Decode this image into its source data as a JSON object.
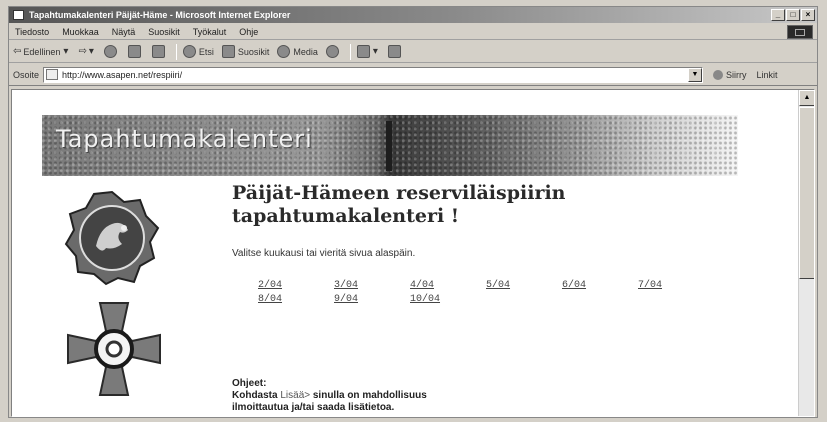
{
  "window": {
    "title": "Tapahtumakalenteri Päijät-Häme - Microsoft Internet Explorer",
    "buttons": {
      "minimize": "_",
      "maximize": "□",
      "close": "×"
    }
  },
  "menu": [
    "Tiedosto",
    "Muokkaa",
    "Näytä",
    "Suosikit",
    "Työkalut",
    "Ohje"
  ],
  "toolbar": {
    "back": "Edellinen",
    "search": "Etsi",
    "favorites": "Suosikit",
    "media": "Media"
  },
  "address": {
    "label": "Osoite",
    "url": "http://www.asapen.net/respiiri/",
    "go": "Siirry",
    "links": "Linkit"
  },
  "page": {
    "banner_title": "Tapahtumakalenteri",
    "heading": "Päijät-Hämeen reserviläispiirin tapahtumakalenteri !",
    "intro": "Valitse kuukausi tai vieritä sivua alaspäin.",
    "months_row1": [
      "2/04",
      "3/04",
      "4/04",
      "5/04",
      "6/04",
      "7/04"
    ],
    "months_row2": [
      "8/04",
      "9/04",
      "10/04"
    ],
    "instructions_title": "Ohjeet:",
    "instructions_line1_pre": "Kohdasta ",
    "instructions_more": "Lisää>",
    "instructions_line1_post": " sinulla on mahdollisuus",
    "instructions_line2": "ilmoittautua ja/tai saada lisätietoa."
  },
  "colors": {
    "chrome": "#d4d0c8",
    "link": "#444444",
    "heading": "#2a2a2a"
  },
  "icons": [
    "app-icon",
    "back-icon",
    "forward-icon",
    "stop-icon",
    "refresh-icon",
    "home-icon",
    "search-icon",
    "favorites-icon",
    "media-icon",
    "history-icon",
    "mail-icon",
    "print-icon",
    "page-icon",
    "go-icon",
    "lion-emblem-icon",
    "cross-emblem-icon"
  ]
}
